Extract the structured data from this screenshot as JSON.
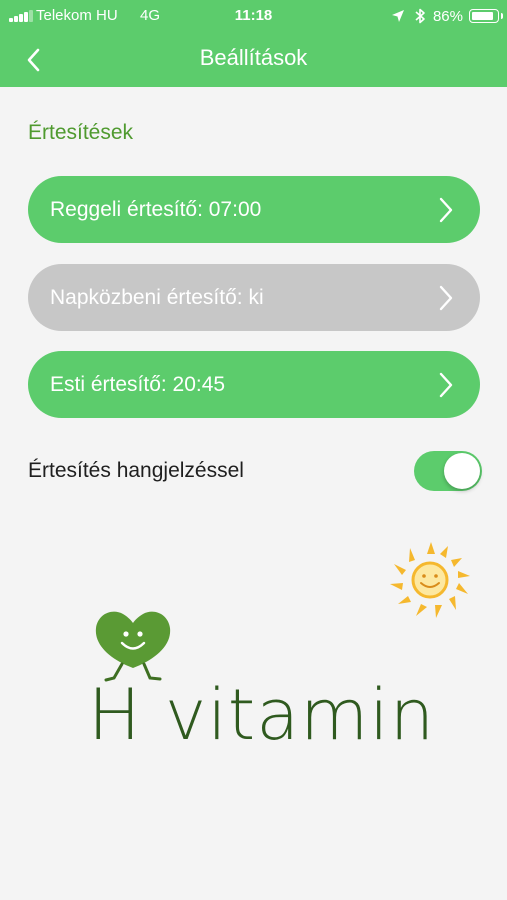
{
  "status_bar": {
    "carrier": "Telekom HU",
    "network": "4G",
    "time": "11:18",
    "battery_percent_text": "86%",
    "battery_level": 0.86,
    "icons": [
      "signal-icon",
      "location-arrow-icon",
      "bluetooth-icon",
      "battery-icon"
    ]
  },
  "nav": {
    "back_icon": "chevron-left-icon",
    "title": "Beállítások"
  },
  "notifications": {
    "section_title": "Értesítések",
    "items": [
      {
        "label": "Reggeli értesítő: 07:00",
        "state": "on",
        "color": "#5ccc6c",
        "icon": "chevron-right-icon"
      },
      {
        "label": "Napközbeni értesítő: ki",
        "state": "off",
        "color": "#c7c7c7",
        "icon": "chevron-right-icon"
      },
      {
        "label": "Esti értesítő: 20:45",
        "state": "on",
        "color": "#5ccc6c",
        "icon": "chevron-right-icon"
      }
    ]
  },
  "sound": {
    "label": "Értesítés hangjelzéssel",
    "enabled": true
  },
  "brand": {
    "name": "H vitamin",
    "logo_icons": [
      "sun-icon",
      "heart-mascot-icon"
    ]
  },
  "colors": {
    "accent": "#5ccc6c",
    "section_title": "#4f9a2f",
    "disabled": "#c7c7c7",
    "background": "#f4f4f4",
    "brand_text": "#2f5a1f",
    "sun": "#f5b82e"
  }
}
